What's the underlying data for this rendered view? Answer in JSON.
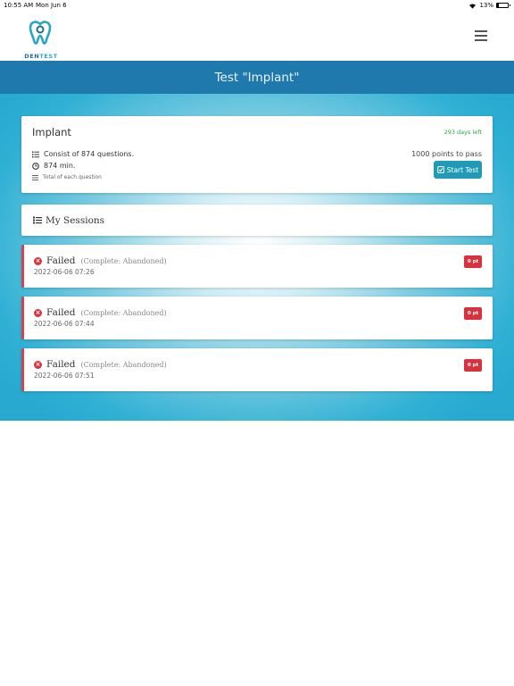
{
  "status_bar": {
    "time": "10:55 AM",
    "date": "Mon Jun 6",
    "battery_text": "13%",
    "battery_level": 0.13
  },
  "header": {
    "logo_part1": "DEN",
    "logo_part2": "TEST",
    "menu_icon": "hamburger-icon"
  },
  "page_title": "Test \"Implant\"",
  "test_card": {
    "name": "Implant",
    "days_left": "293 days left",
    "questions": "Consist of 874 questions.",
    "duration": "874 min.",
    "note": "Total of each question",
    "points_to_pass": "1000 points to pass",
    "start_label": "Start Test"
  },
  "sessions_header": "My Sessions",
  "sessions": [
    {
      "status": "Failed",
      "detail": "(Complete: Abandoned)",
      "timestamp": "2022-06-06 07:26",
      "points": "0 pt"
    },
    {
      "status": "Failed",
      "detail": "(Complete: Abandoned)",
      "timestamp": "2022-06-06 07:44",
      "points": "0 pt"
    },
    {
      "status": "Failed",
      "detail": "(Complete: Abandoned)",
      "timestamp": "2022-06-06 07:51",
      "points": "0 pt"
    }
  ],
  "colors": {
    "primary": "#1f79ad",
    "accent": "#1f9bb7",
    "danger": "#d8323f",
    "success": "#2da14a"
  }
}
